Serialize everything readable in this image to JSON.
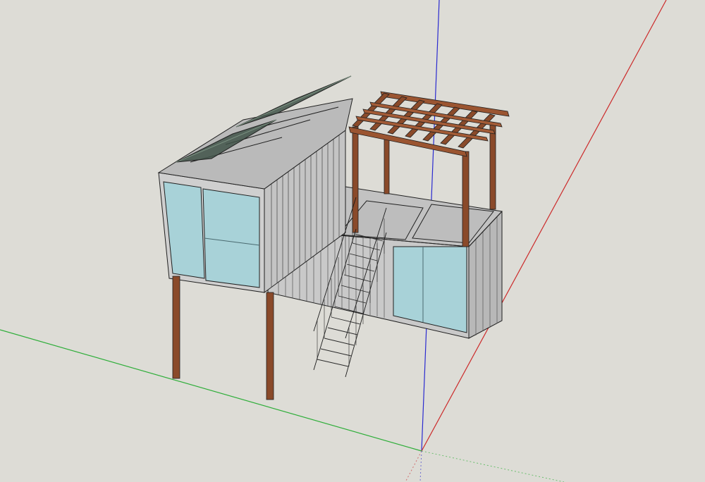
{
  "app": {
    "name": ""
  },
  "model": {
    "subject": "container-house-with-pergola"
  },
  "axes": {
    "red": "#cc2a2a",
    "green": "#2fae3a",
    "blue": "#2a2ad0"
  },
  "colors": {
    "background": "#dddcd6",
    "container": "#c9c9c9",
    "container_dark": "#b5b5b5",
    "glass": "#a8d2d8",
    "wood": "#8a4a2a",
    "wood_light": "#9b5531",
    "solar": "#3f5248",
    "outline": "#202020"
  }
}
